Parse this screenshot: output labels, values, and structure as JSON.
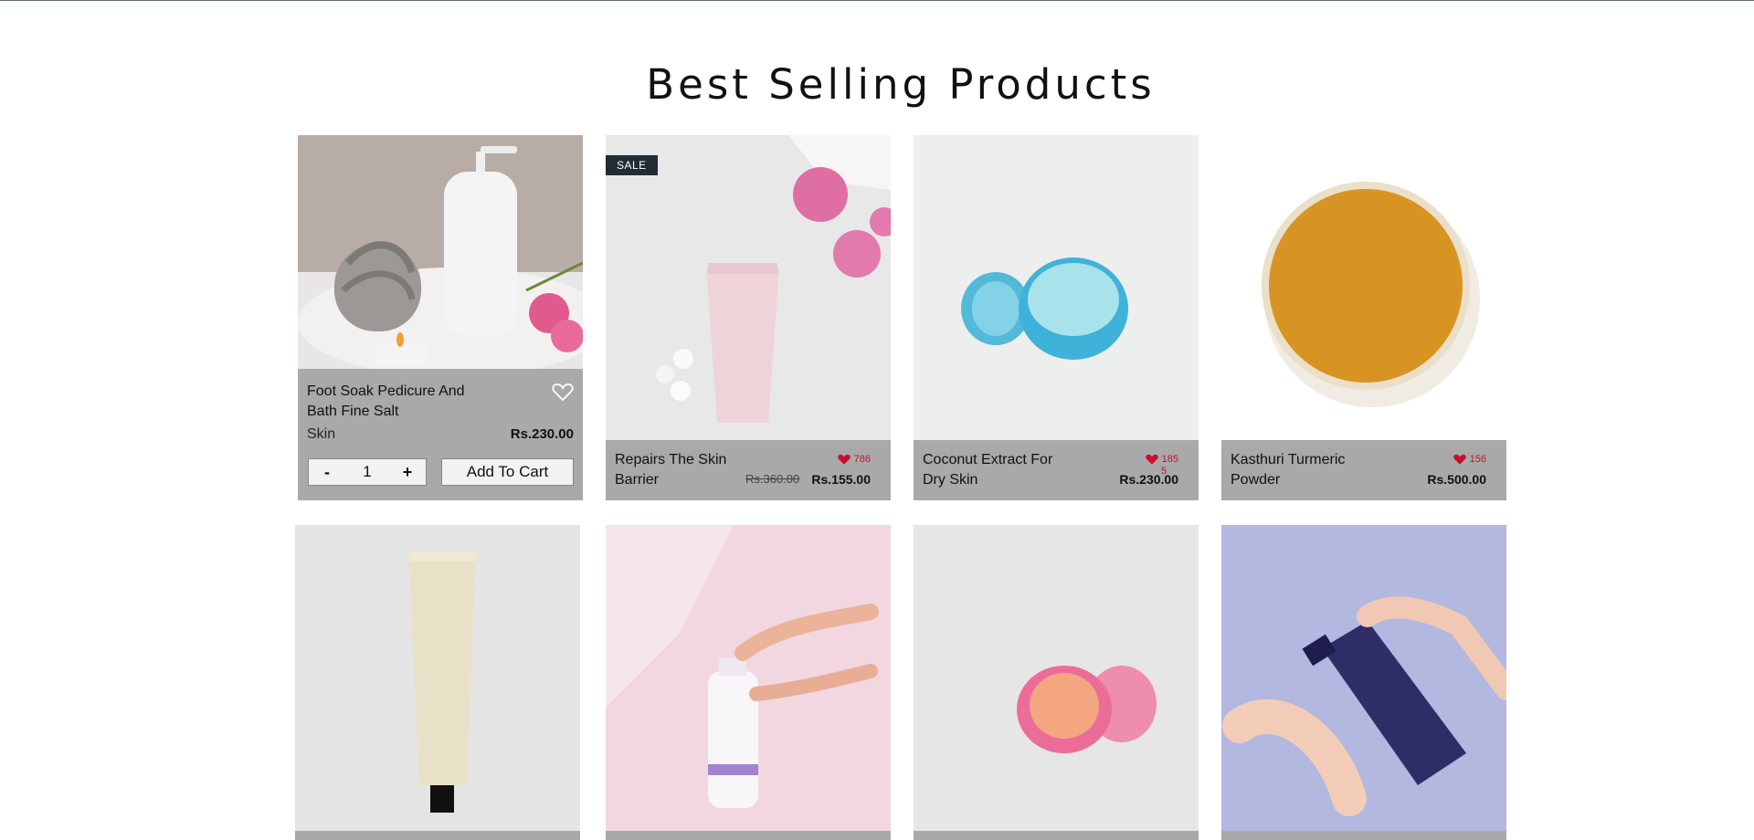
{
  "section": {
    "title": "Best Selling Products"
  },
  "products": [
    {
      "name_line1": "Foot Soak Pedicure And",
      "name_line2": "Bath Fine Salt",
      "category": "Skin",
      "price": "Rs.230.00",
      "qty": "1",
      "qty_minus": "-",
      "qty_plus": "+",
      "add_to_cart": "Add To Cart",
      "icon": "heart-outline-icon"
    },
    {
      "badge": "SALE",
      "name_line1": "Repairs The Skin",
      "name_line2": "Barrier",
      "likes": "786",
      "old_price": "Rs.360.00",
      "price": "Rs.155.00",
      "icon": "heart-filled-icon"
    },
    {
      "name_line1": "Coconut Extract For",
      "name_line2": "Dry Skin",
      "likes": "185",
      "likes_overflow": "5",
      "price": "Rs.230.00",
      "icon": "heart-filled-icon"
    },
    {
      "name_line1": "Kasthuri Turmeric",
      "name_line2": "Powder",
      "likes": "156",
      "price": "Rs.500.00",
      "icon": "heart-filled-icon"
    }
  ],
  "colors": {
    "info_bg": "#a9a9a9",
    "sale_badge": "#222c36",
    "like_red": "#c8102e"
  }
}
